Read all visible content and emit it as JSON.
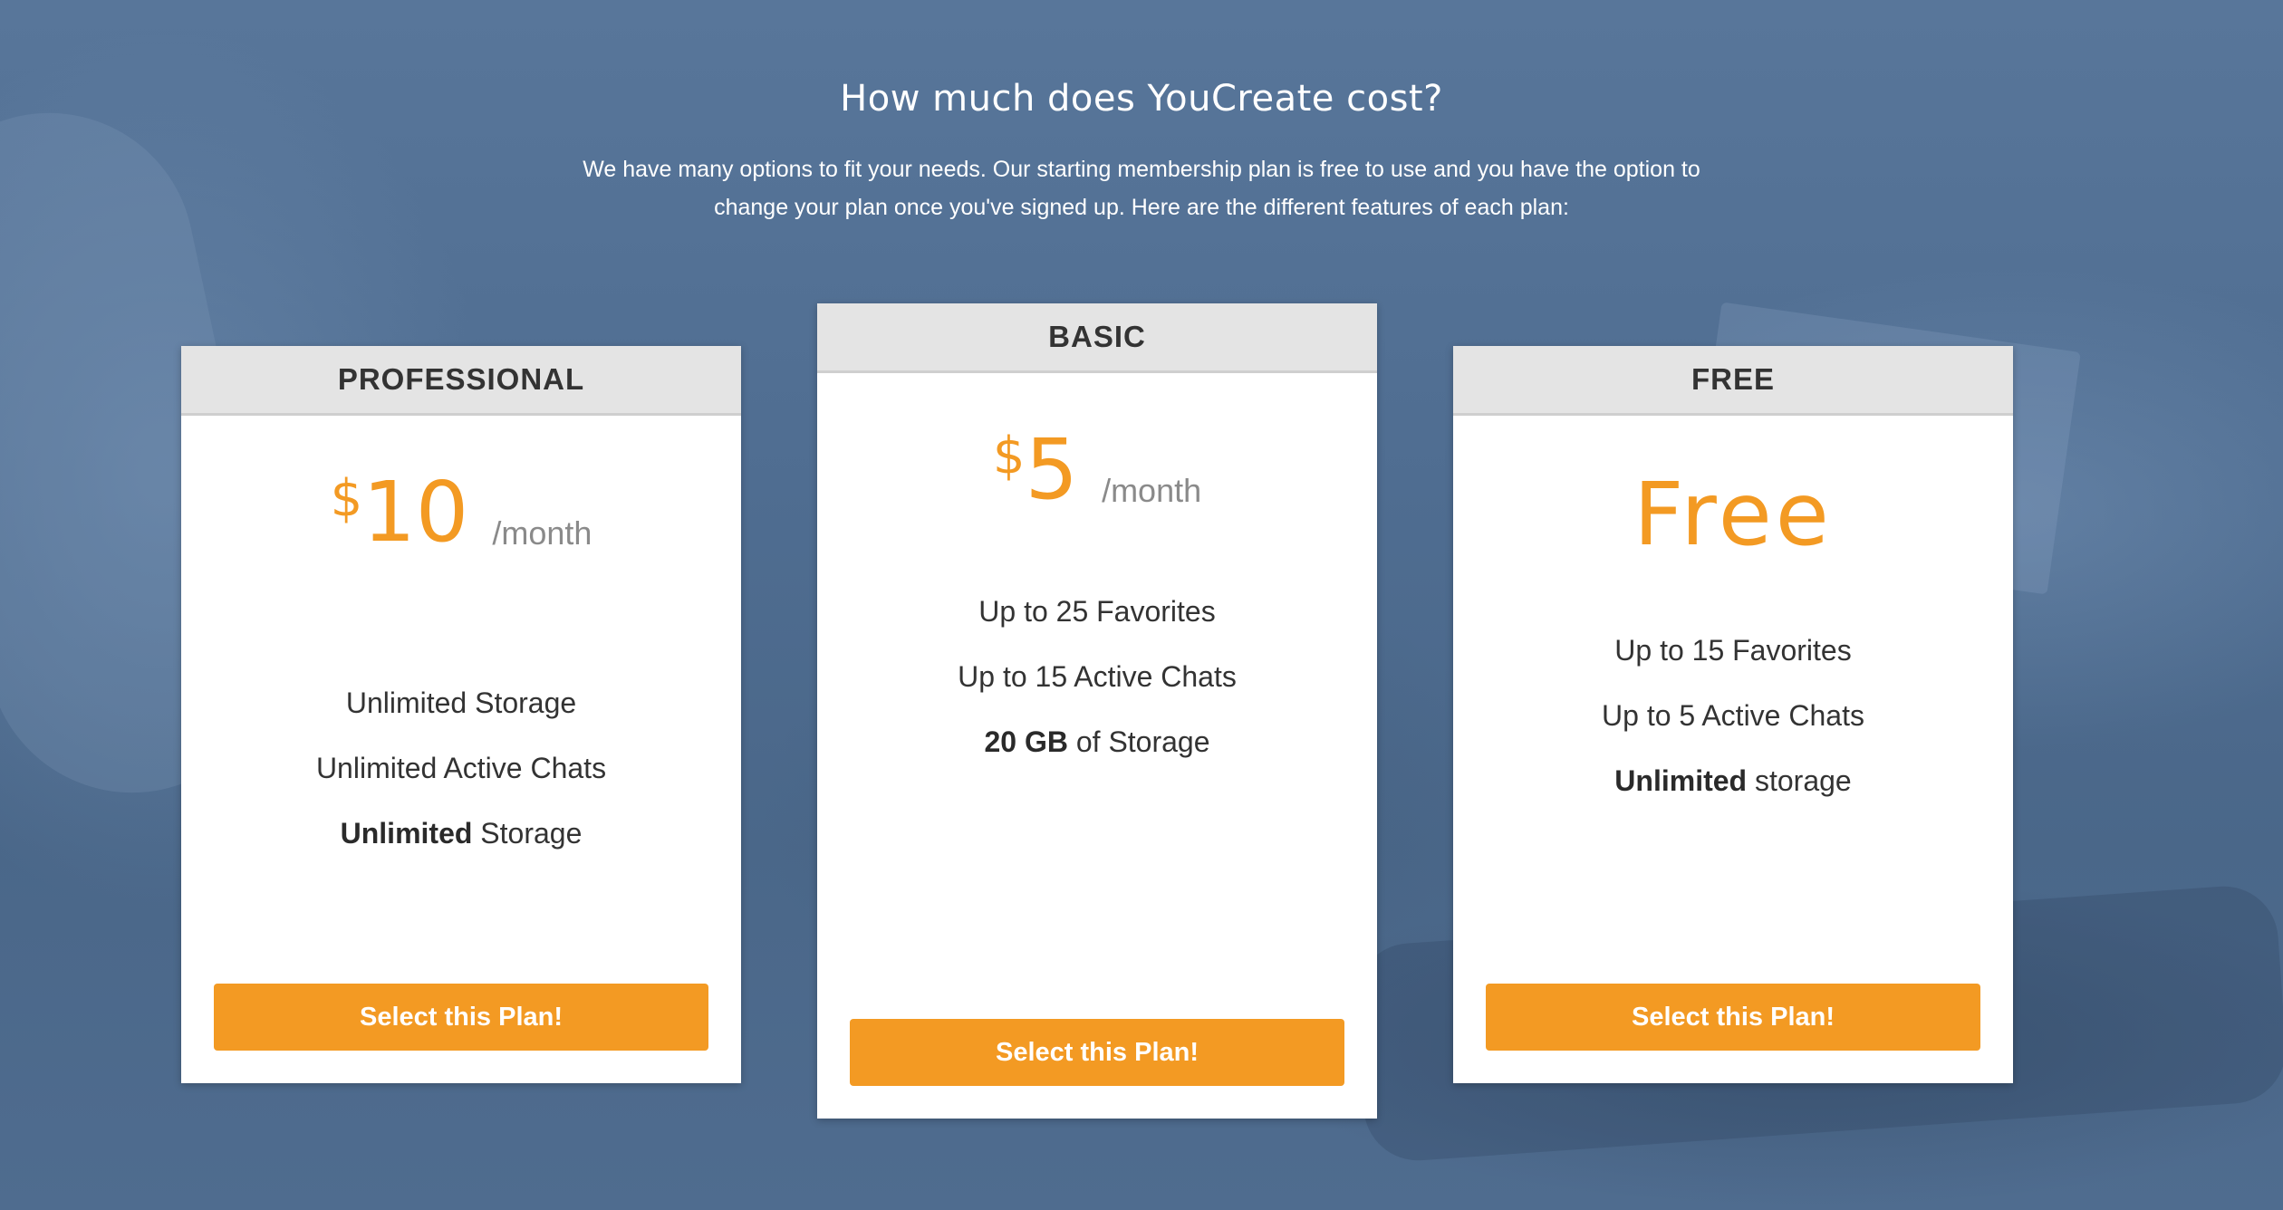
{
  "page": {
    "heading": "How much does YouCreate cost?",
    "intro": "We have many options to fit your needs. Our starting membership plan is free to use and you have the option to change your plan once you've signed up. Here are the different features of each plan:"
  },
  "plans": [
    {
      "name": "PROFESSIONAL",
      "currency": "$",
      "amount": "10",
      "period": "/month",
      "features": [
        {
          "bold": "",
          "text": "Unlimited Storage"
        },
        {
          "bold": "",
          "text": "Unlimited Active Chats"
        },
        {
          "bold": "Unlimited",
          "text": " Storage"
        }
      ],
      "button_label": "Select this Plan!"
    },
    {
      "name": "BASIC",
      "currency": "$",
      "amount": "5",
      "period": "/month",
      "features": [
        {
          "bold": "",
          "text": "Up to 25 Favorites"
        },
        {
          "bold": "",
          "text": "Up to 15 Active Chats"
        },
        {
          "bold": "20 GB",
          "text": " of Storage"
        }
      ],
      "button_label": "Select this Plan!"
    },
    {
      "name": "FREE",
      "price_text": "Free",
      "features": [
        {
          "bold": "",
          "text": "Up to 15 Favorites"
        },
        {
          "bold": "",
          "text": "Up to 5 Active Chats"
        },
        {
          "bold": "Unlimited",
          "text": " storage"
        }
      ],
      "button_label": "Select this Plan!"
    }
  ],
  "colors": {
    "accent": "#f39a23",
    "background": "#4f6d91",
    "card_header": "#e4e4e4"
  }
}
